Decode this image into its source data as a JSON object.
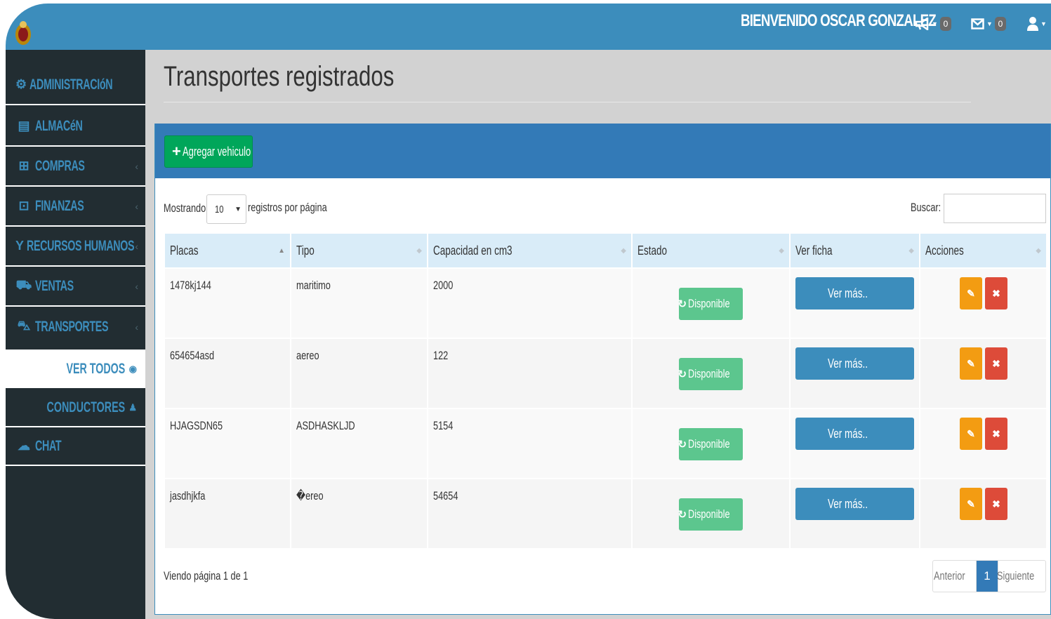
{
  "colors": {
    "primary": "#3c8dbc",
    "sidebar": "#222d32",
    "success": "#00a65a",
    "warning": "#f39c12",
    "danger": "#dd4b39"
  },
  "header": {
    "welcome": "BIENVENIDO OSCAR GONZALEZ",
    "notifications_count": "0",
    "messages_count": "0"
  },
  "sidebar": {
    "items": [
      {
        "label": "ADMINISTRACIóN",
        "icon": "dashboard-icon"
      },
      {
        "label": "ALMACéN",
        "icon": "archive-icon"
      },
      {
        "label": "COMPRAS",
        "icon": "shopping-cart-icon"
      },
      {
        "label": "FINANZAS",
        "icon": "money-icon"
      },
      {
        "label": "RECURSOS HUMANOS",
        "icon": "users-icon"
      },
      {
        "label": "VENTAS",
        "icon": "truck-icon"
      },
      {
        "label": "TRANSPORTES",
        "icon": "car-icon"
      }
    ],
    "sub_items": [
      {
        "label": "VER TODOS",
        "icon": "eye-icon",
        "active": true
      },
      {
        "label": "CONDUCTORES",
        "icon": "user-icon",
        "active": false
      }
    ],
    "chat": {
      "label": "CHAT",
      "icon": "chat-icon"
    }
  },
  "main": {
    "title": "Transportes registrados",
    "add_button": "Agregar vehiculo",
    "length": {
      "prefix": "Mostrando",
      "value": "10",
      "suffix": "registros por página"
    },
    "search_label": "Buscar:",
    "columns": [
      "Placas",
      "Tipo",
      "Capacidad en cm3",
      "Estado",
      "Ver ficha",
      "Acciones"
    ],
    "rows": [
      {
        "placa": "1478kj144",
        "tipo": "maritimo",
        "capacidad": "2000",
        "estado": "Disponible",
        "ver": "Ver más.."
      },
      {
        "placa": "654654asd",
        "tipo": "aereo",
        "capacidad": "122",
        "estado": "Disponible",
        "ver": "Ver más.."
      },
      {
        "placa": "HJAGSDN65",
        "tipo": "ASDHASKLJD",
        "capacidad": "5154",
        "estado": "Disponible",
        "ver": "Ver más.."
      },
      {
        "placa": "jasdhjkfa",
        "tipo": "�ereo",
        "capacidad": "54654",
        "estado": "Disponible",
        "ver": "Ver más.."
      }
    ],
    "info": "Viendo página 1 de 1",
    "pagination": {
      "prev": "Anterior",
      "current": "1",
      "next": "Siguiente"
    }
  }
}
